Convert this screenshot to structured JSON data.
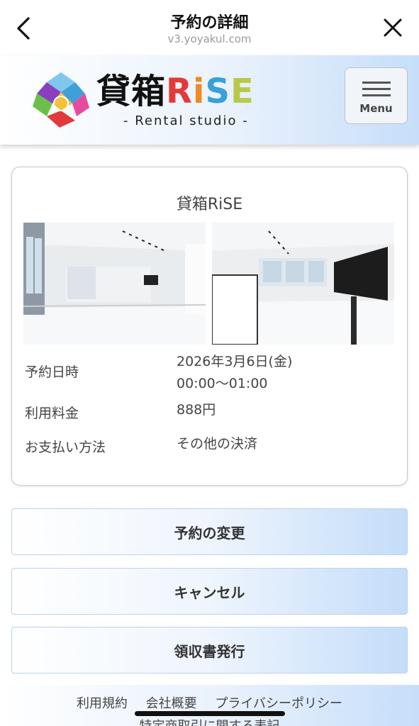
{
  "topbar": {
    "title": "予約の詳細",
    "url": "v3.yoyakul.com"
  },
  "header": {
    "brand_kanji": "貸箱",
    "brand_r": "R",
    "brand_i": "i",
    "brand_s": "S",
    "brand_e": "E",
    "brand_sub": "- Rental studio -",
    "menu_label": "Menu"
  },
  "card": {
    "studio_name": "貸箱RiSE",
    "rows": [
      {
        "label": "予約日時",
        "value_line1": "2026年3月6日(金)",
        "value_line2": "00:00～01:00"
      },
      {
        "label": "利用料金",
        "value_line1": "888円"
      },
      {
        "label": "お支払い方法",
        "value_line1": "その他の決済"
      }
    ]
  },
  "actions": {
    "change": "予約の変更",
    "cancel": "キャンセル",
    "receipt": "領収書発行"
  },
  "footer": {
    "terms": "利用規約",
    "company": "会社概要",
    "privacy": "プライバシーポリシー",
    "commerce": "特定商取引に関する表記"
  },
  "icons": {
    "back": "chevron-left-icon",
    "close": "close-icon",
    "menu": "hamburger-icon"
  }
}
